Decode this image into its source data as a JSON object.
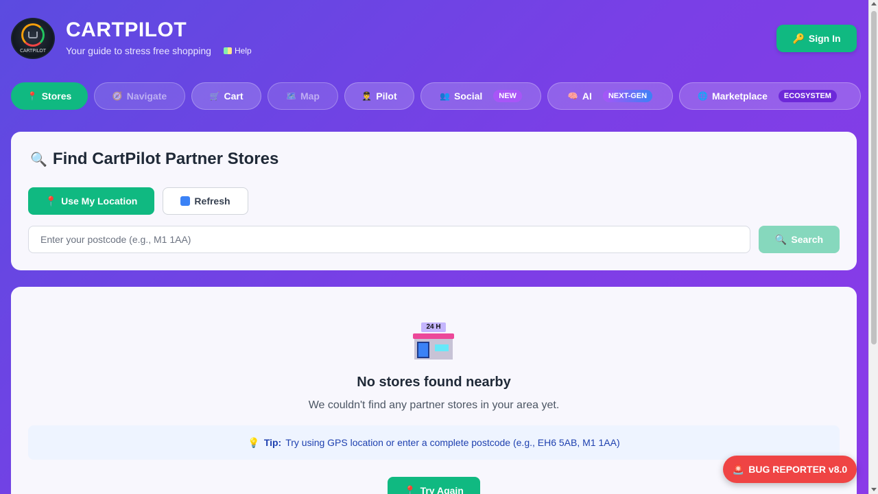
{
  "header": {
    "title": "CARTPILOT",
    "tagline": "Your guide to stress free shopping",
    "help_label": "Help",
    "logo_text": "CARTPILOT",
    "signin_icon": "🔑",
    "signin_label": "Sign In"
  },
  "nav": {
    "tabs": [
      {
        "icon": "📍",
        "label": "Stores"
      },
      {
        "icon": "🧭",
        "label": "Navigate"
      },
      {
        "icon": "🛒",
        "label": "Cart"
      },
      {
        "icon": "🗺️",
        "label": "Map"
      },
      {
        "icon": "👨‍✈️",
        "label": "Pilot"
      },
      {
        "icon": "👥",
        "label": "Social",
        "badge": "NEW"
      },
      {
        "icon": "🧠",
        "label": "AI",
        "badge": "NEXT-GEN"
      },
      {
        "icon": "🌐",
        "label": "Marketplace",
        "badge": "ECOSYSTEM"
      }
    ]
  },
  "search": {
    "title_icon": "🔍",
    "title": "Find CartPilot Partner Stores",
    "use_location_icon": "📍",
    "use_location_label": "Use My Location",
    "refresh_label": "Refresh",
    "postcode_placeholder": "Enter your postcode (e.g., M1 1AA)",
    "postcode_value": "",
    "search_icon": "🔍",
    "search_label": "Search"
  },
  "results": {
    "store_sign": "24 H",
    "empty_title": "No stores found nearby",
    "empty_subtitle": "We couldn't find any partner stores in your area yet.",
    "tip_icon": "💡",
    "tip_label": "Tip:",
    "tip_text": "Try using GPS location or enter a complete postcode (e.g., EH6 5AB, M1 1AA)",
    "try_again_icon": "📍",
    "try_again_label": "Try Again"
  },
  "bug_reporter": {
    "icon": "🚨",
    "label": "BUG REPORTER v8.0"
  },
  "colors": {
    "accent_green": "#10b981",
    "bug_red": "#ef4444",
    "bg_purple": "#7a3fe6"
  }
}
